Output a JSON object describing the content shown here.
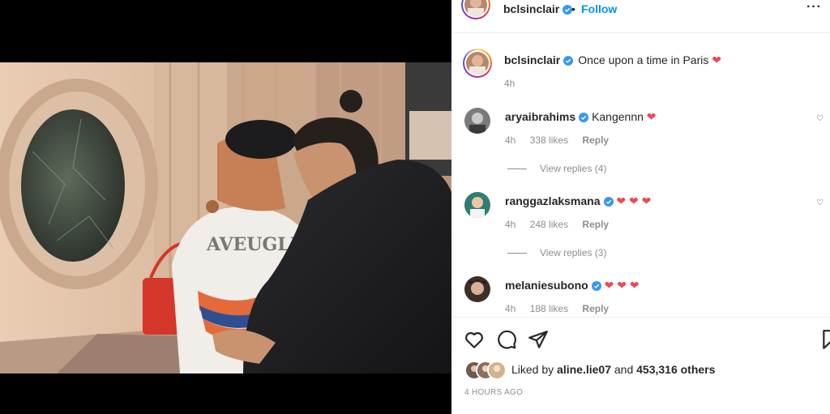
{
  "post": {
    "author": "bclsinclair",
    "header_separator": "•",
    "follow_label": "Follow",
    "more_label": "···",
    "caption_text": "Once upon a time in Paris",
    "caption_emoji": "❤",
    "caption_time": "4h",
    "sweater_text": "AVEUGLE"
  },
  "comments": [
    {
      "user": "aryaibrahims",
      "text": "Kangennn",
      "emoji": "❤",
      "time": "4h",
      "likes": "338 likes",
      "reply": "Reply",
      "view_replies": "View replies (4)"
    },
    {
      "user": "ranggazlaksmana",
      "text": "",
      "emoji": "❤ ❤ ❤",
      "time": "4h",
      "likes": "248 likes",
      "reply": "Reply",
      "view_replies": "View replies (3)"
    },
    {
      "user": "melaniesubono",
      "text": "",
      "emoji": "❤ ❤ ❤",
      "time": "4h",
      "likes": "188 likes",
      "reply": "Reply",
      "view_replies": ""
    }
  ],
  "actions": {
    "icons": [
      "heart-icon",
      "comment-icon",
      "share-icon",
      "bookmark-icon"
    ]
  },
  "likes": {
    "prefix": "Liked by",
    "user": "aline.lie07",
    "middle": "and",
    "others": "453,316 others"
  },
  "timestamp": "4 HOURS AGO",
  "colors": {
    "link": "#0095f6",
    "heart": "#ed4956",
    "verified": "#3897f0",
    "muted": "#8e8e8e"
  }
}
